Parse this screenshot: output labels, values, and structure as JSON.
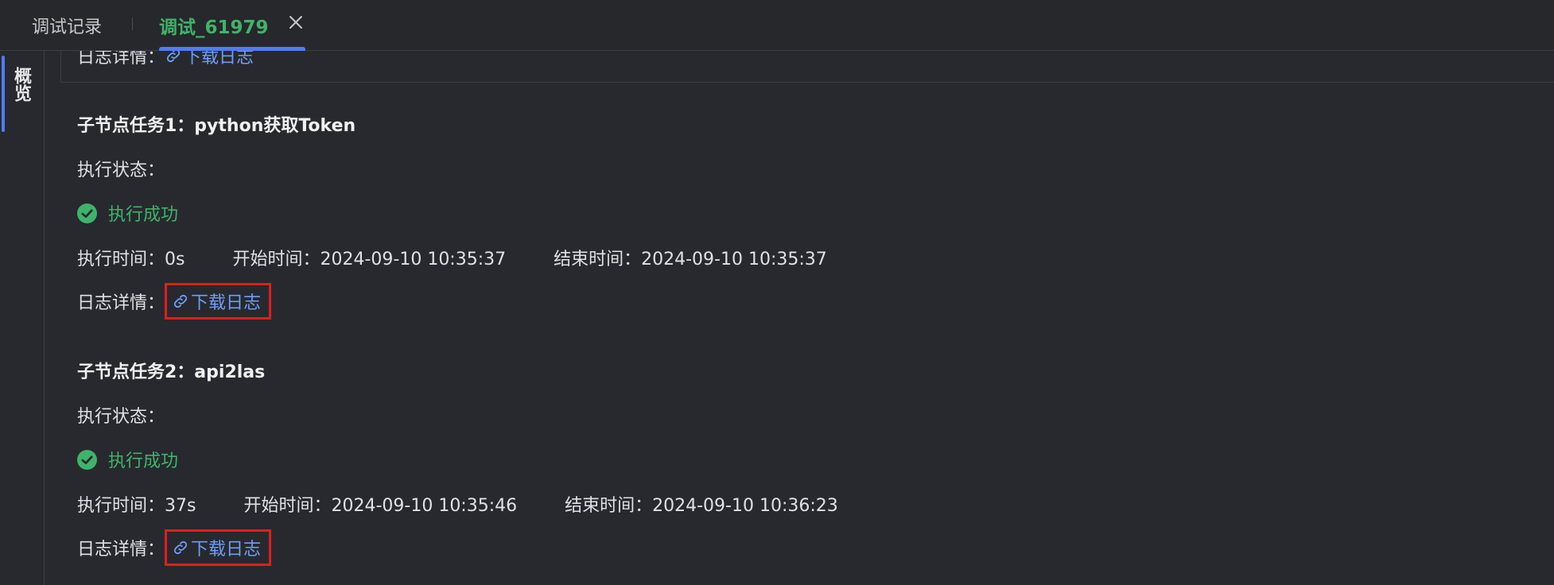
{
  "tabs": {
    "records_label": "调试记录",
    "debug_label": "调试_61979"
  },
  "sidebar": {
    "overview_label": "概览"
  },
  "top_partial": {
    "log_label": "日志详情：",
    "download_label": "下载日志"
  },
  "nodes": [
    {
      "title": "子节点任务1：python获取Token",
      "status_label": "执行状态：",
      "status_value": "执行成功",
      "exec_time": "执行时间：0s",
      "start_time": "开始时间：2024-09-10 10:35:37",
      "end_time": "结束时间：2024-09-10 10:35:37",
      "log_label": "日志详情：",
      "download_label": "下载日志"
    },
    {
      "title": "子节点任务2：api2las",
      "status_label": "执行状态：",
      "status_value": "执行成功",
      "exec_time": "执行时间：37s",
      "start_time": "开始时间：2024-09-10 10:35:46",
      "end_time": "结束时间：2024-09-10 10:36:23",
      "log_label": "日志详情：",
      "download_label": "下载日志"
    }
  ],
  "colors": {
    "success": "#3fb36a",
    "link": "#6f9df8",
    "accent": "#4f7cf7",
    "highlight_box": "#e21d1d"
  },
  "icons": [
    "close-icon",
    "check-circle-icon",
    "link-icon"
  ]
}
